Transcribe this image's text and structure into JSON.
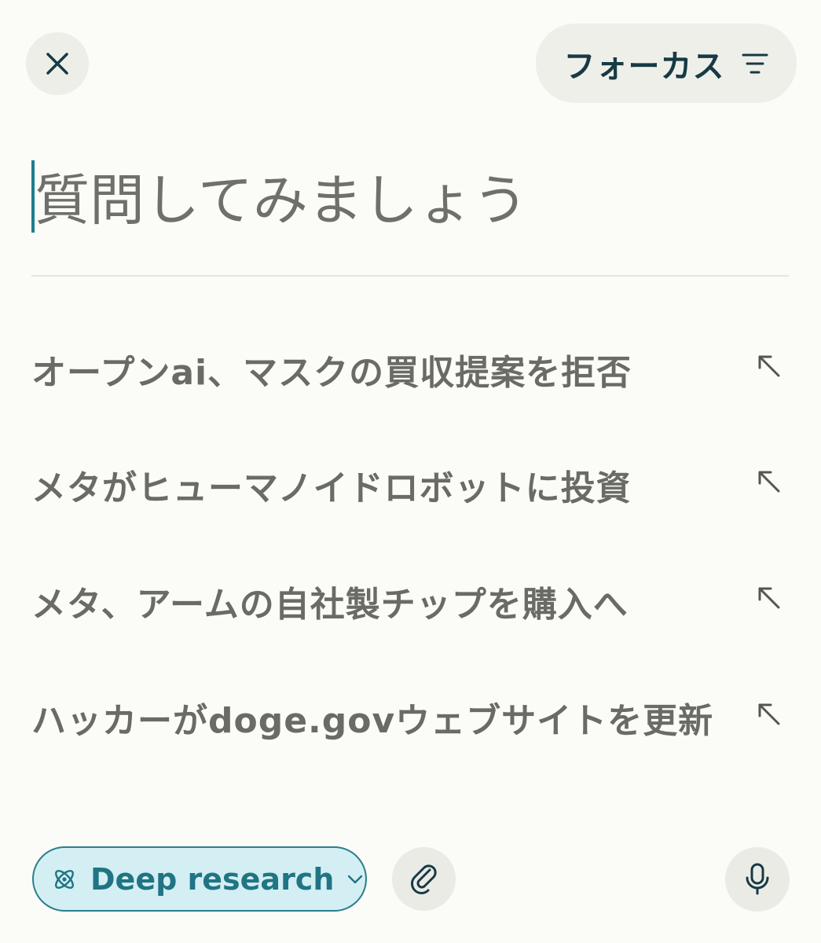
{
  "header": {
    "close_icon": "close-icon",
    "focus_label": "フォーカス",
    "focus_icon": "filter-lines-icon"
  },
  "prompt": {
    "placeholder": "質問してみましょう",
    "value": ""
  },
  "suggestions": [
    {
      "label": "オープンai、マスクの買収提案を拒否",
      "icon": "arrow-up-left-icon"
    },
    {
      "label": "メタがヒューマノイドロボットに投資",
      "icon": "arrow-up-left-icon"
    },
    {
      "label": "メタ、アームの自社製チップを購入へ",
      "icon": "arrow-up-left-icon"
    },
    {
      "label": "ハッカーがdoge.govウェブサイトを更新",
      "icon": "arrow-up-left-icon"
    }
  ],
  "toolbar": {
    "deep_research_label": "Deep research",
    "deep_research_icon": "atom-icon",
    "deep_research_chevron": "chevron-down-icon",
    "attach_icon": "paperclip-icon",
    "mic_icon": "microphone-icon"
  },
  "colors": {
    "background": "#fbfbf7",
    "accent": "#207484",
    "accent_bg": "#d3eff3",
    "button_bg": "#eeeee9",
    "text_muted": "#6a6a66"
  }
}
